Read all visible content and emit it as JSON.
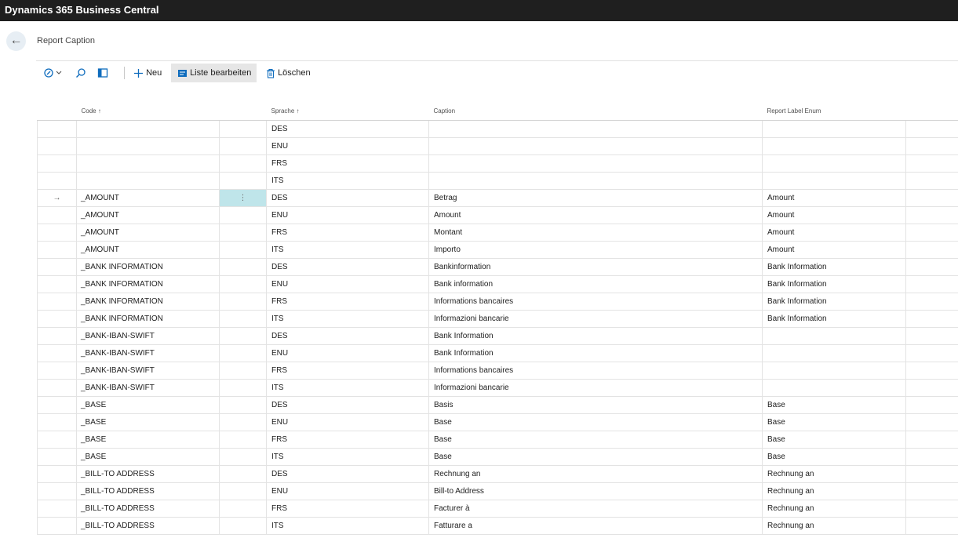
{
  "app": {
    "title": "Dynamics 365 Business Central"
  },
  "page": {
    "title": "Report Caption"
  },
  "toolbar": {
    "new_label": "Neu",
    "edit_list_label": "Liste bearbeiten",
    "delete_label": "Löschen"
  },
  "columns": {
    "code": "Code ↑",
    "language": "Sprache ↑",
    "caption": "Caption",
    "enum": "Report Label Enum"
  },
  "rows": [
    {
      "code": "",
      "language": "DES",
      "caption": "",
      "enum": ""
    },
    {
      "code": "",
      "language": "ENU",
      "caption": "",
      "enum": ""
    },
    {
      "code": "",
      "language": "FRS",
      "caption": "",
      "enum": ""
    },
    {
      "code": "",
      "language": "ITS",
      "caption": "",
      "enum": ""
    },
    {
      "code": "_AMOUNT",
      "language": "DES",
      "caption": "Betrag",
      "enum": "Amount"
    },
    {
      "code": "_AMOUNT",
      "language": "ENU",
      "caption": "Amount",
      "enum": "Amount"
    },
    {
      "code": "_AMOUNT",
      "language": "FRS",
      "caption": "Montant",
      "enum": "Amount"
    },
    {
      "code": "_AMOUNT",
      "language": "ITS",
      "caption": "Importo",
      "enum": "Amount"
    },
    {
      "code": "_BANK INFORMATION",
      "language": "DES",
      "caption": "Bankinformation",
      "enum": "Bank Information"
    },
    {
      "code": "_BANK INFORMATION",
      "language": "ENU",
      "caption": "Bank information",
      "enum": "Bank Information"
    },
    {
      "code": "_BANK INFORMATION",
      "language": "FRS",
      "caption": "Informations bancaires",
      "enum": "Bank Information"
    },
    {
      "code": "_BANK INFORMATION",
      "language": "ITS",
      "caption": "Informazioni bancarie",
      "enum": "Bank Information"
    },
    {
      "code": "_BANK-IBAN-SWIFT",
      "language": "DES",
      "caption": "Bank Information",
      "enum": ""
    },
    {
      "code": "_BANK-IBAN-SWIFT",
      "language": "ENU",
      "caption": "Bank Information",
      "enum": ""
    },
    {
      "code": "_BANK-IBAN-SWIFT",
      "language": "FRS",
      "caption": "Informations bancaires",
      "enum": ""
    },
    {
      "code": "_BANK-IBAN-SWIFT",
      "language": "ITS",
      "caption": "Informazioni bancarie",
      "enum": ""
    },
    {
      "code": "_BASE",
      "language": "DES",
      "caption": "Basis",
      "enum": "Base"
    },
    {
      "code": "_BASE",
      "language": "ENU",
      "caption": "Base",
      "enum": "Base"
    },
    {
      "code": "_BASE",
      "language": "FRS",
      "caption": "Base",
      "enum": "Base"
    },
    {
      "code": "_BASE",
      "language": "ITS",
      "caption": "Base",
      "enum": "Base"
    },
    {
      "code": "_BILL-TO ADDRESS",
      "language": "DES",
      "caption": "Rechnung an",
      "enum": "Rechnung an"
    },
    {
      "code": "_BILL-TO ADDRESS",
      "language": "ENU",
      "caption": "Bill-to Address",
      "enum": "Rechnung an"
    },
    {
      "code": "_BILL-TO ADDRESS",
      "language": "FRS",
      "caption": "Facturer à",
      "enum": "Rechnung an"
    },
    {
      "code": "_BILL-TO ADDRESS",
      "language": "ITS",
      "caption": "Fatturare a",
      "enum": "Rechnung an"
    }
  ],
  "selected_row_index": 4,
  "icons": {
    "back": "back-arrow-icon",
    "views": "analysis-views-icon",
    "search": "search-icon",
    "filter_pane": "filter-pane-icon",
    "new": "plus-icon",
    "edit_list": "edit-list-icon",
    "delete": "trash-icon",
    "selected": "row-arrow-icon",
    "row_actions": "more-vertical-icon"
  },
  "colors": {
    "topbar": "#1f1f1f",
    "accent": "#0f6cbd",
    "selected_cell": "#bfe5ea"
  }
}
